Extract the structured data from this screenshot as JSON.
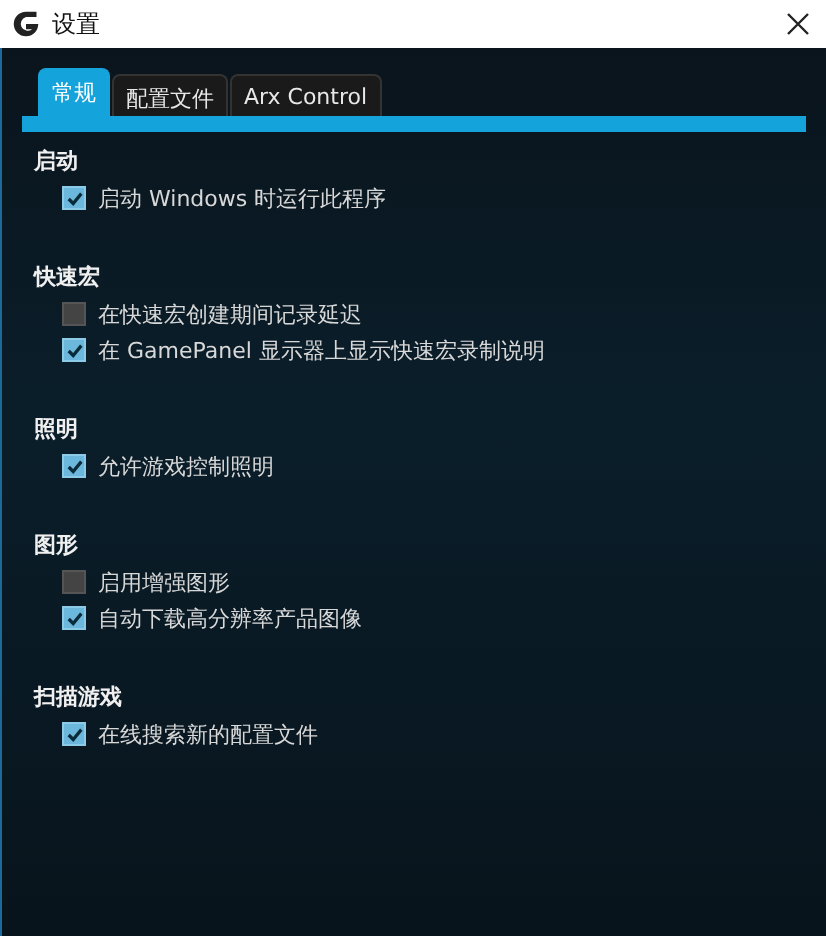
{
  "window": {
    "title": "设置"
  },
  "tabs": [
    {
      "label": "常规",
      "selected": true
    },
    {
      "label": "配置文件",
      "selected": false
    },
    {
      "label": "Arx Control",
      "selected": false
    }
  ],
  "sections": [
    {
      "heading": "启动",
      "options": [
        {
          "label": "启动 Windows 时运行此程序",
          "checked": true
        }
      ]
    },
    {
      "heading": "快速宏",
      "options": [
        {
          "label": "在快速宏创建期间记录延迟",
          "checked": false
        },
        {
          "label": "在 GamePanel 显示器上显示快速宏录制说明",
          "checked": true
        }
      ]
    },
    {
      "heading": "照明",
      "options": [
        {
          "label": "允许游戏控制照明",
          "checked": true
        }
      ]
    },
    {
      "heading": "图形",
      "options": [
        {
          "label": "启用增强图形",
          "checked": false
        },
        {
          "label": "自动下载高分辨率产品图像",
          "checked": true
        }
      ]
    },
    {
      "heading": "扫描游戏",
      "options": [
        {
          "label": "在线搜索新的配置文件",
          "checked": true
        }
      ]
    }
  ]
}
